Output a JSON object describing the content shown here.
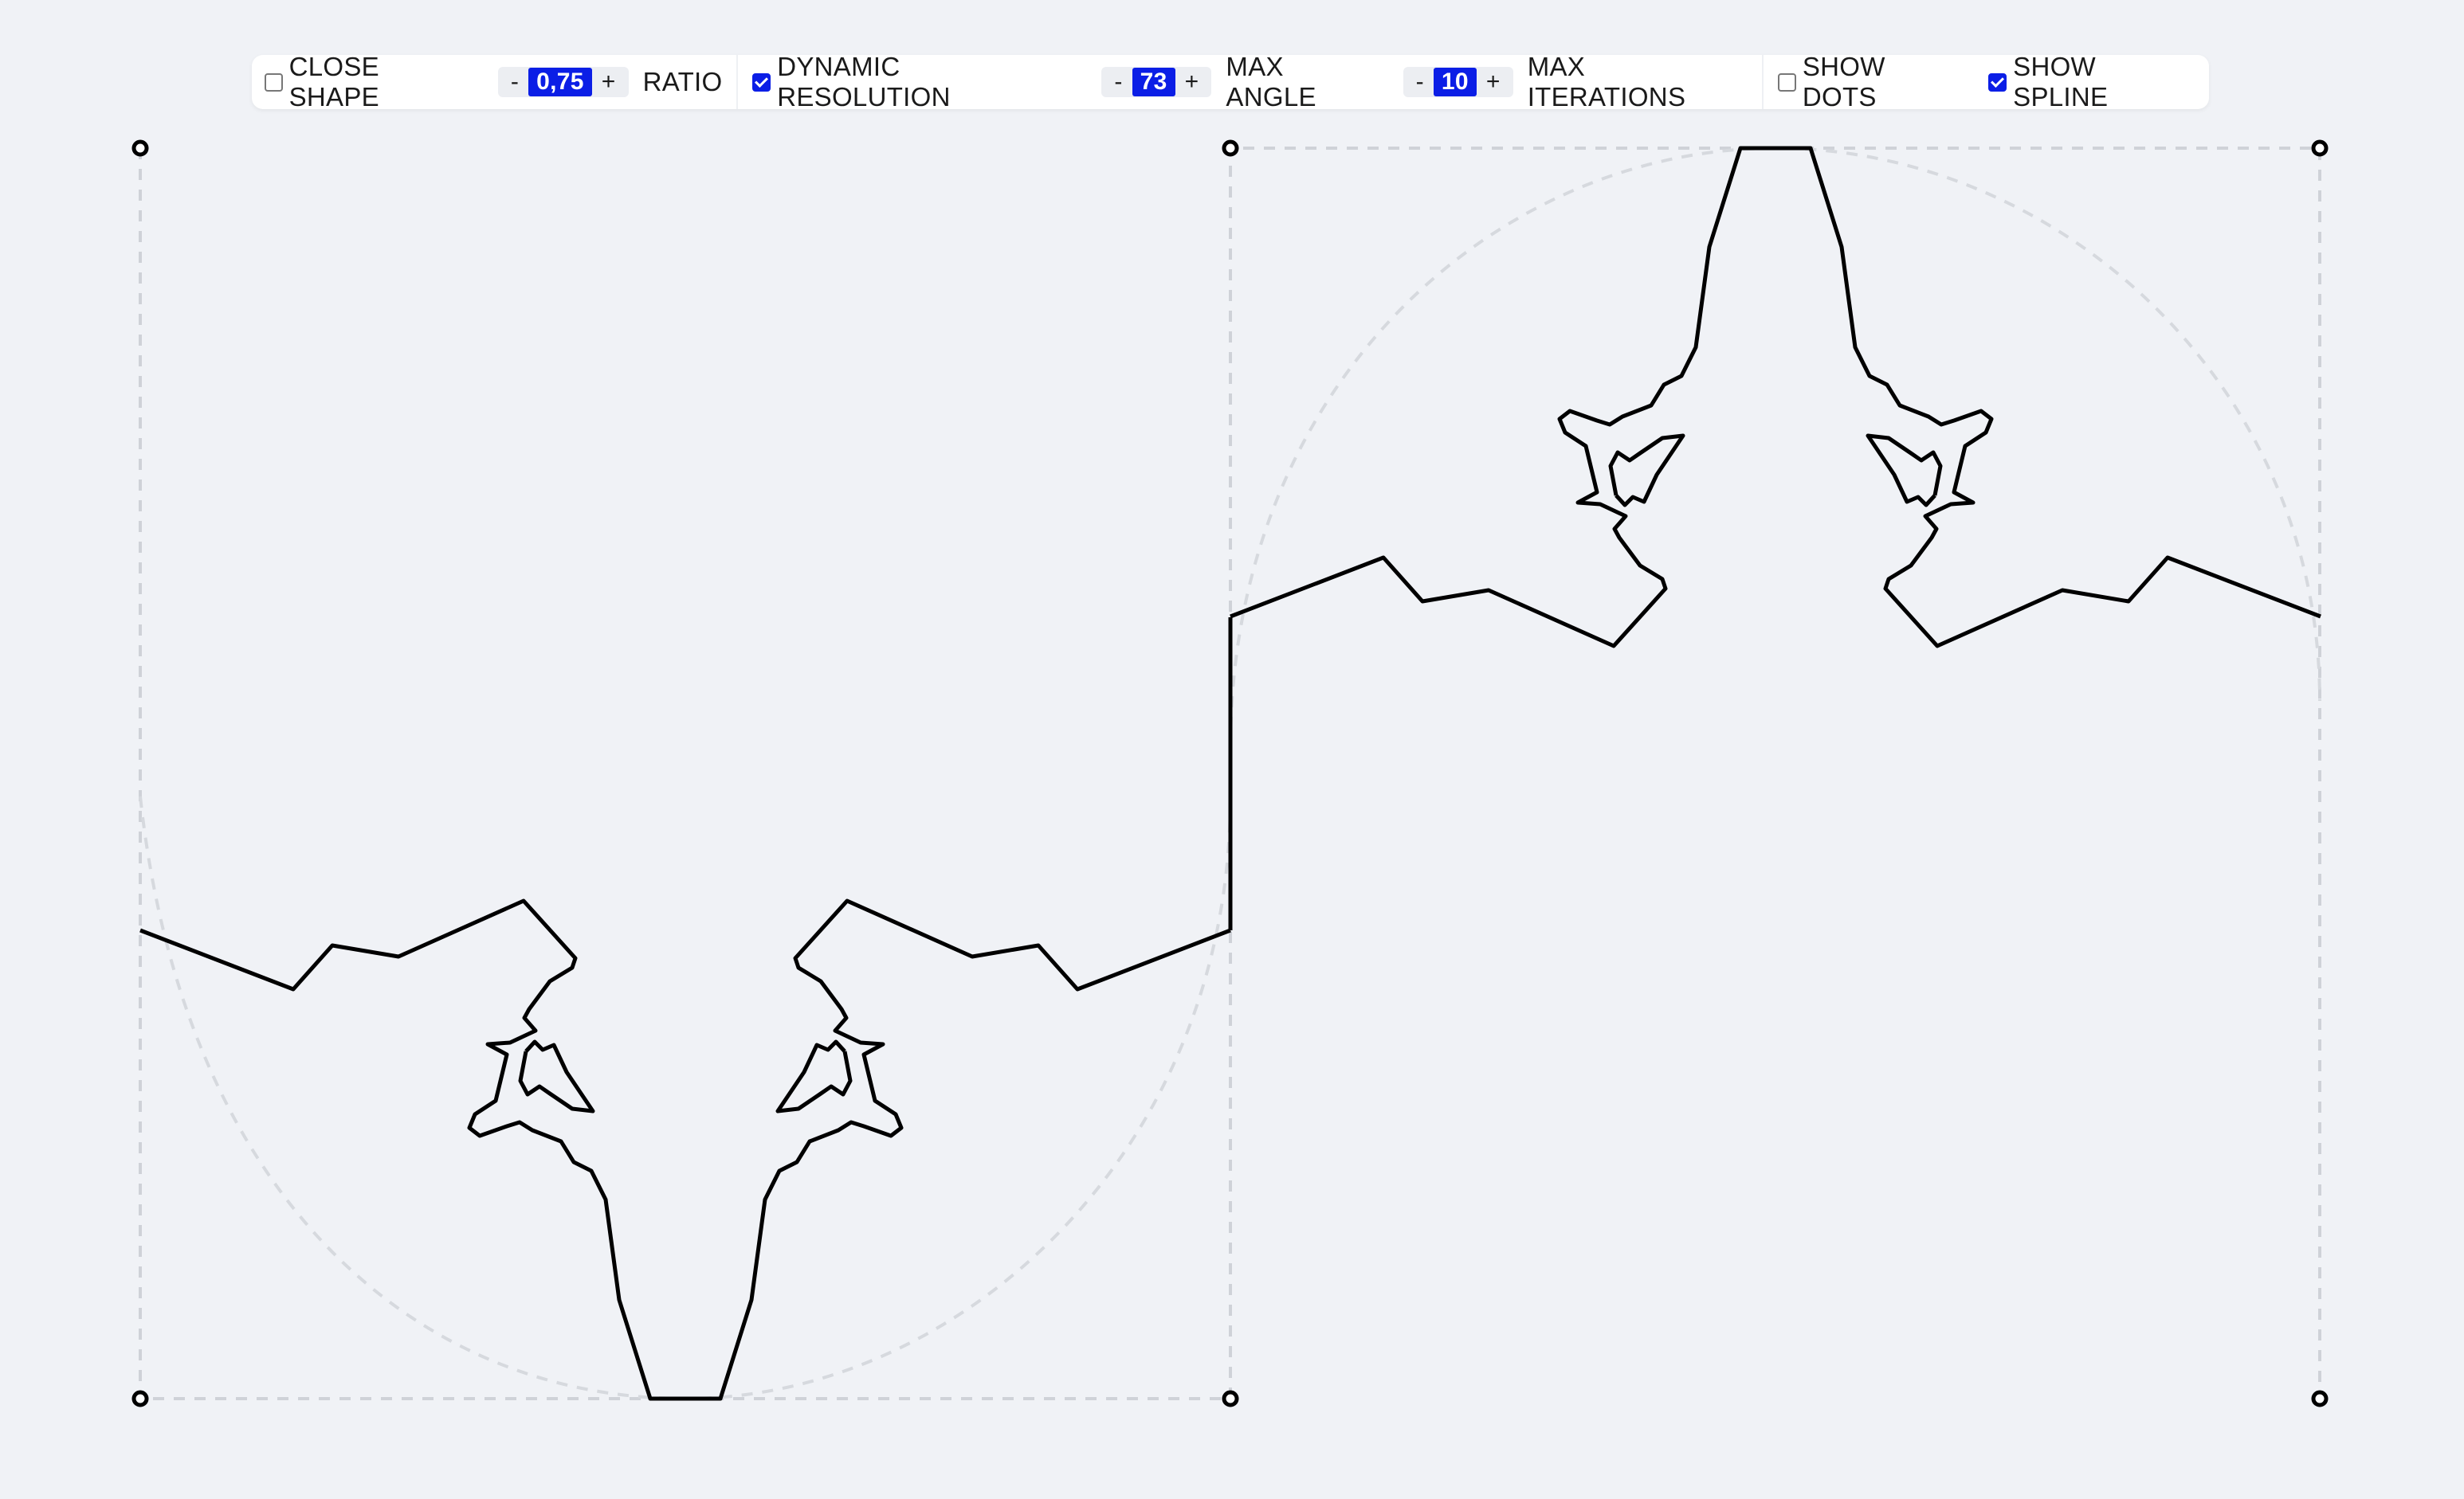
{
  "toolbar": {
    "close_shape": {
      "label": "CLOSE SHAPE",
      "checked": false
    },
    "ratio": {
      "decrement": "-",
      "value": "0,75",
      "increment": "+",
      "label": "RATIO"
    },
    "dynamic_resolution": {
      "label": "DYNAMIC RESOLUTION",
      "checked": true
    },
    "max_angle": {
      "decrement": "-",
      "value": "73",
      "increment": "+",
      "label": "MAX ANGLE"
    },
    "max_iterations": {
      "decrement": "-",
      "value": "10",
      "increment": "+",
      "label": "MAX ITERATIONS"
    },
    "show_dots": {
      "label": "SHOW DOTS",
      "checked": false
    },
    "show_spline": {
      "label": "SHOW SPLINE",
      "checked": true
    }
  },
  "colors": {
    "background": "#f0f2f6",
    "accent": "#0b1ee6",
    "stroke": "#000000",
    "guide": "#cfd2d8"
  },
  "icons": {
    "control_point": "control-point-icon",
    "checkbox": "checkbox-icon"
  }
}
